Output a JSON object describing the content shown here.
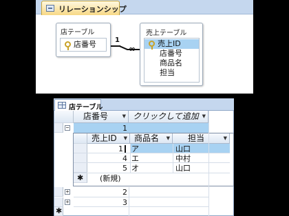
{
  "relationship_window": {
    "tab_label": "リレーションシップ",
    "table_a": {
      "title": "店テーブル",
      "fields": [
        "店番号"
      ]
    },
    "table_b": {
      "title": "売上テーブル",
      "fields": [
        "売上ID",
        "店番号",
        "商品名",
        "担当"
      ]
    },
    "relation": {
      "one": "1",
      "many": "∞"
    }
  },
  "datasheet": {
    "tab_label": "店テーブル",
    "columns": [
      "店番号",
      "クリックして追加"
    ],
    "rows": [
      {
        "value": "1",
        "expander": "−"
      },
      {
        "value": "2",
        "expander": "+"
      },
      {
        "value": "3",
        "expander": "+"
      }
    ],
    "subdatasheet": {
      "columns": [
        "売上ID",
        "商品名",
        "担当"
      ],
      "rows": [
        {
          "id": "1",
          "product": "ア",
          "person": "山口"
        },
        {
          "id": "4",
          "product": "エ",
          "person": "中村"
        },
        {
          "id": "5",
          "product": "オ",
          "person": "山口"
        }
      ],
      "new_row_marker": "✱",
      "new_row_label": "(新規)"
    },
    "new_row_marker": "✱"
  }
}
